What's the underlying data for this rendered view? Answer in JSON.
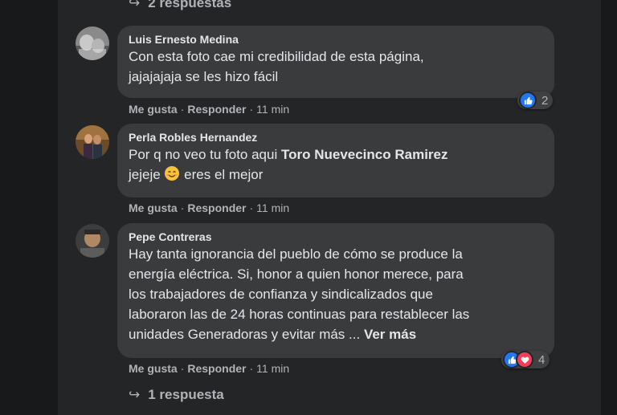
{
  "top_replies": {
    "label": "2 respuestas"
  },
  "comments": [
    {
      "author": "Luis Ernesto Medina",
      "line1": "Con esta foto cae mi credibilidad de esta página,",
      "line2": "jajajajaja se les hizo fácil",
      "like_label": "Me gusta",
      "reply_label": "Responder",
      "time": "11 min",
      "reaction_count": "2"
    },
    {
      "author": "Perla Robles Hernandez",
      "text_pre": "Por q no veo tu foto aqui ",
      "mention": "Toro Nuevecinco Ramirez",
      "line2_pre": "jejeje ",
      "emoji": "smiling-face-emoji",
      "line2_post": " eres el mejor",
      "like_label": "Me gusta",
      "reply_label": "Responder",
      "time": "11 min"
    },
    {
      "author": "Pepe Contreras",
      "lines": [
        "Hay tanta ignorancia del pueblo de cómo se produce la",
        "energía eléctrica. Si, honor a quien honor merece, para",
        "los trabajadores de confianza y sindicalizados que",
        "laboraron las de 24 horas continuas para restablecer las"
      ],
      "last_line": "unidades Generadoras y evitar más ... ",
      "see_more": "Ver más",
      "like_label": "Me gusta",
      "reply_label": "Responder",
      "time": "11 min",
      "reaction_count": "4"
    }
  ],
  "bottom_replies": {
    "label": "1 respuesta"
  },
  "separator": "·",
  "reply_arrow": "↪",
  "colors": {
    "bubble": "#3a3b3c",
    "like": "#2078f4",
    "love": "#f33e58",
    "panel": "#242526"
  }
}
